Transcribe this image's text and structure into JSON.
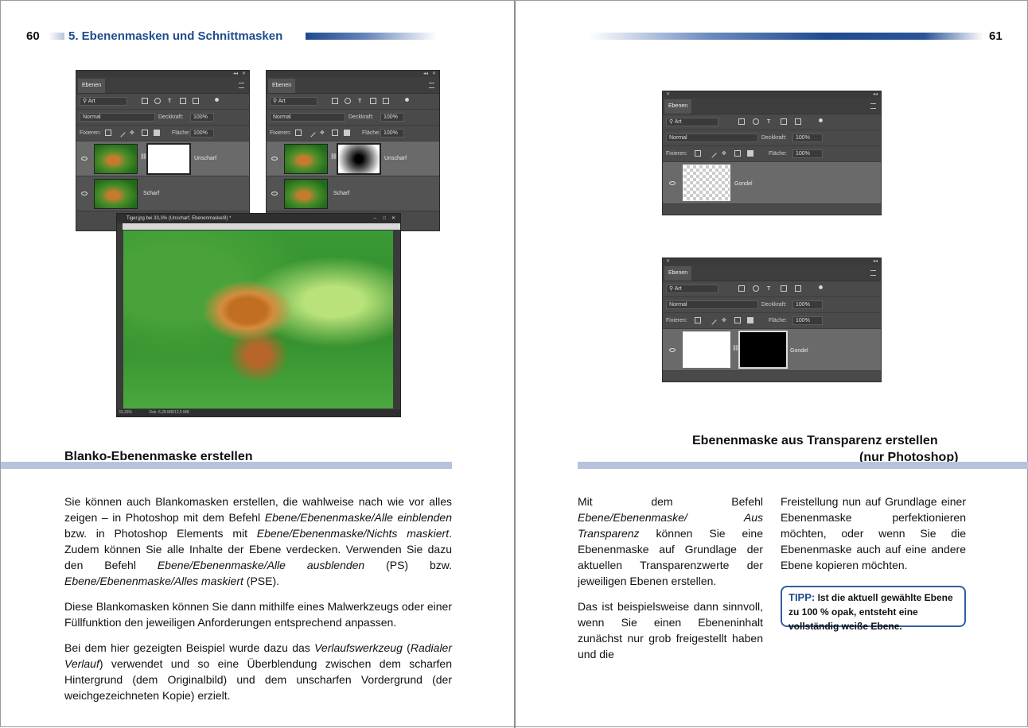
{
  "left_page": {
    "page_number": "60",
    "chapter_title": "5. Ebenenmasken und Schnittmasken",
    "heading": "Blanko-Ebenenmaske erstellen",
    "paragraphs": [
      [
        "Sie können auch Blankomasken erstellen, die wahlweise nach wie vor alles zeigen – in Photoshop mit dem Befehl ",
        {
          "i": "Ebene/Ebenenmaske/Alle einblenden"
        },
        " bzw. in Photoshop Elements mit ",
        {
          "i": "Ebene/Ebenenmaske/Nichts maskiert"
        },
        ". Zudem können Sie alle Inhalte der Ebene verdecken. Verwenden Sie dazu den Befehl ",
        {
          "i": "Ebene/Ebenenmaske/Alle ausblenden"
        },
        " (PS) bzw. ",
        {
          "i": "Ebene/Ebenenmaske/Alles maskiert"
        },
        " (PSE)."
      ],
      [
        "Diese Blankomasken können Sie dann mithilfe eines Malwerkzeugs oder einer Füllfunktion den jeweiligen Anforderungen entsprechend anpassen."
      ],
      [
        "Bei dem hier gezeigten Beispiel wurde dazu das ",
        {
          "i": "Verlaufswerkzeug"
        },
        " (",
        {
          "i": "Radialer Verlauf"
        },
        ") verwendet und so eine Überblendung zwischen dem scharfen Hintergrund (dem Originalbild) und dem unscharfen Vordergrund (der weichgezeichneten Kopie) erzielt."
      ]
    ],
    "panel1": {
      "tab": "Ebenen",
      "filter": "Art",
      "blend": "Normal",
      "opacity_label": "Deckkraft:",
      "opacity": "100%",
      "lock_label": "Fixieren:",
      "fill_label": "Fläche:",
      "fill": "100%",
      "layer_top": "Unscharf",
      "layer_bottom": "Scharf"
    },
    "panel2": {
      "tab": "Ebenen",
      "filter": "Art",
      "blend": "Normal",
      "opacity_label": "Deckkraft:",
      "opacity": "100%",
      "lock_label": "Fixieren:",
      "fill_label": "Fläche:",
      "fill": "100%",
      "layer_top": "Unscharf",
      "layer_bottom": "Scharf"
    },
    "doc_window": {
      "title": "Tiger.jpg bei 33,3% (Unscharf, Ebenenmaske/8) *",
      "zoom": "33,33%",
      "doc_size": "Dok: 6,28 MB/12,5 MB"
    }
  },
  "right_page": {
    "page_number": "61",
    "heading_line1": "Ebenenmaske aus Transparenz erstellen",
    "heading_line2": "(nur Photoshop)",
    "col1": [
      [
        "Mit dem Befehl ",
        {
          "i": "Ebene/Ebenenmaske/ Aus Transparenz"
        },
        " können Sie eine Ebenenmaske auf Grundlage der aktuellen Transparenzwerte der jeweiligen Ebenen erstellen."
      ],
      [
        "Das ist beispielsweise dann sinnvoll, wenn Sie einen Ebeneninhalt zunächst nur grob freigestellt haben und die"
      ]
    ],
    "col2": [
      [
        "Freistellung nun auf Grundlage einer Ebenenmaske perfektionieren möchten, oder wenn Sie die Ebenenmaske auch auf eine andere Ebene kopieren möchten."
      ]
    ],
    "tip_label": "TIPP:",
    "tip_text": "Ist die aktuell gewählte Ebene zu 100 % opak, entsteht eine vollständig weiße Ebene.",
    "panel3": {
      "tab": "Ebenen",
      "filter": "Art",
      "blend": "Normal",
      "opacity_label": "Deckkraft:",
      "opacity": "100%",
      "lock_label": "Fixieren:",
      "fill_label": "Fläche:",
      "fill": "100%",
      "layer": "Gondel"
    },
    "panel4": {
      "tab": "Ebenen",
      "filter": "Art",
      "blend": "Normal",
      "opacity_label": "Deckkraft:",
      "opacity": "100%",
      "lock_label": "Fixieren:",
      "fill_label": "Fläche:",
      "fill": "100%",
      "layer": "Gondel"
    }
  },
  "colors": {
    "accent_blue": "#1e4b8f",
    "heading_bar": "#b8c2dc",
    "tip_border": "#2f5fa0"
  }
}
